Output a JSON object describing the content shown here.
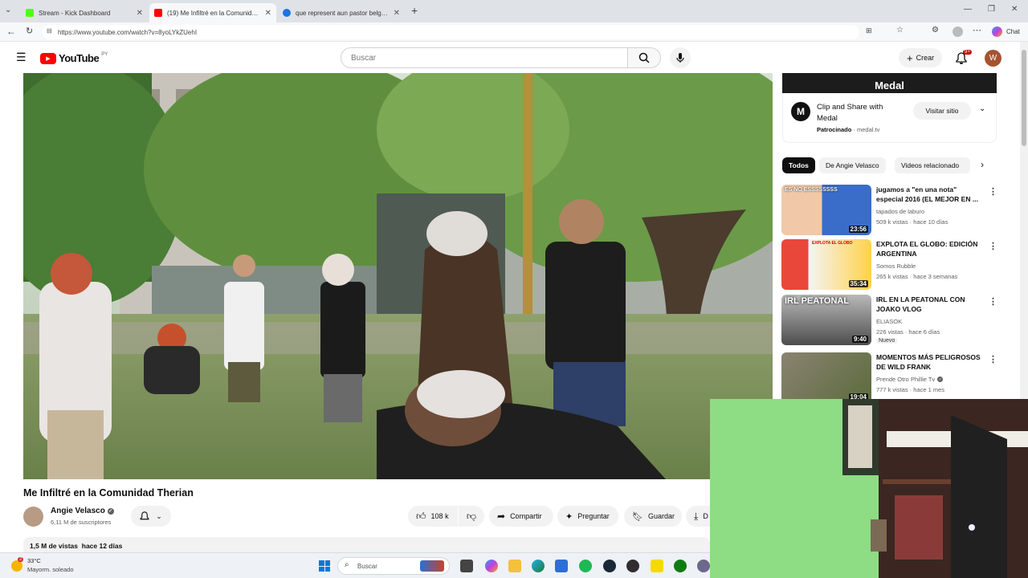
{
  "browser": {
    "tabs": [
      {
        "title": "Stream - Kick Dashboard",
        "color": "#53fc18"
      },
      {
        "title": "(19) Me Infiltré en la Comunidad T",
        "color": "#ff0000"
      },
      {
        "title": "que represent aun pastor belga - B",
        "color": "#1a73e8"
      }
    ],
    "url": "https://www.youtube.com/watch?v=8yoLYkZUehI",
    "chat_label": "Chat"
  },
  "youtube": {
    "logo_text": "YouTube",
    "region": "PY",
    "search_placeholder": "Buscar",
    "create_label": "Crear",
    "notif_count": "9+",
    "avatar_letter": "W"
  },
  "video": {
    "title": "Me Infiltré en la Comunidad Therian",
    "channel": "Angie Velasco",
    "subscribers": "6,11 M de suscriptores",
    "likes": "108 k",
    "share_label": "Compartir",
    "ask_label": "Preguntar",
    "save_label": "Guardar",
    "download_label": "D",
    "views": "1,5 M de vistas",
    "age": "hace 12 días"
  },
  "ad": {
    "banner_text": "Medal",
    "title": "Clip and Share with Medal",
    "sponsored": "Patrocinado",
    "domain": "medal.tv",
    "visit_label": "Visitar sitio"
  },
  "chips": [
    "Todos",
    "De Angie Velasco",
    "Videos relacionado"
  ],
  "related": [
    {
      "title": "jugamos a \"en una nota\" especial 2016 (EL MEJOR EN ...",
      "channel": "tapados de laburo",
      "meta": "509 k vistas · hace 10 días",
      "duration": "23:56",
      "badge": "",
      "thumb_text": "ES NO ESSSSSSSS",
      "verified": false
    },
    {
      "title": "EXPLOTA EL GLOBO: EDICIÓN ARGENTINA",
      "channel": "Somos Rubble",
      "meta": "265 k vistas · hace 3 semanas",
      "duration": "35:34",
      "badge": "",
      "thumb_text": "EXPLOTA EL GLOBO",
      "verified": false
    },
    {
      "title": "IRL EN LA PEATONAL CON JOAKO VLOG",
      "channel": "ELIASOK",
      "meta": "226 vistas · hace 6 días",
      "duration": "9:40",
      "badge": "Nuevo",
      "thumb_text": "IRL PEATONAL",
      "verified": false
    },
    {
      "title": "MOMENTOS MÁS PELIGROSOS DE WILD FRANK",
      "channel": "Prende Otro Phillie Tv",
      "meta": "777 k vistas · hace 1 mes",
      "duration": "19:04",
      "badge": "",
      "thumb_text": "",
      "verified": true
    }
  ],
  "taskbar": {
    "weather_temp": "33°C",
    "weather_desc": "Mayorm. soleado",
    "weather_badge": "2",
    "search_label": "Buscar"
  }
}
